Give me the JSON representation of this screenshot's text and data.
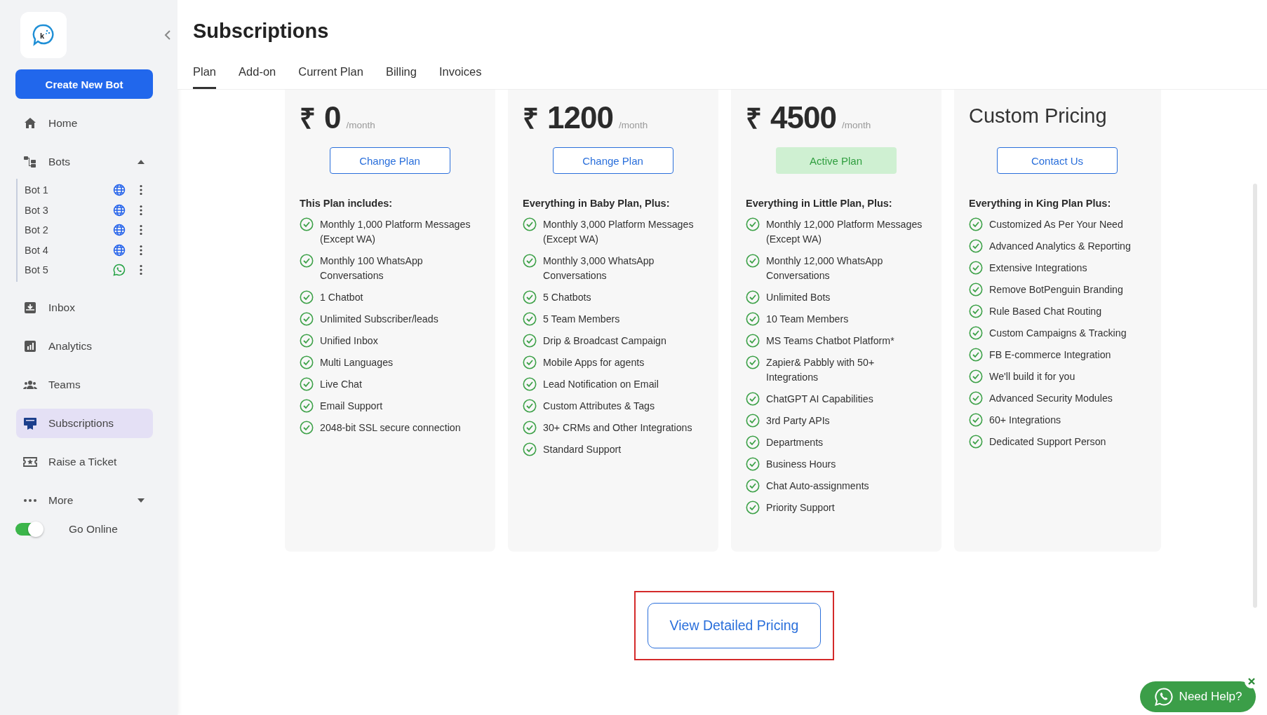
{
  "sidebar": {
    "logo_letter": "k",
    "create_button": "Create New Bot",
    "items": [
      {
        "kind": "home",
        "label": "Home",
        "selected": false
      },
      {
        "kind": "bots",
        "label": "Bots",
        "selected": false,
        "expanded": true,
        "children": [
          {
            "label": "Bot 1",
            "kind": "web"
          },
          {
            "label": "Bot 3",
            "kind": "web"
          },
          {
            "label": "Bot 2",
            "kind": "web"
          },
          {
            "label": "Bot 4",
            "kind": "web"
          },
          {
            "label": "Bot 5",
            "kind": "whatsapp"
          }
        ]
      },
      {
        "kind": "inbox",
        "label": "Inbox",
        "selected": false
      },
      {
        "kind": "analytics",
        "label": "Analytics",
        "selected": false
      },
      {
        "kind": "teams",
        "label": "Teams",
        "selected": false
      },
      {
        "kind": "subscriptions",
        "label": "Subscriptions",
        "selected": true
      },
      {
        "kind": "ticket",
        "label": "Raise a Ticket",
        "selected": false
      },
      {
        "kind": "more",
        "label": "More",
        "selected": false,
        "expanded": false
      }
    ],
    "go_online": {
      "label": "Go Online",
      "on": true
    }
  },
  "page": {
    "title": "Subscriptions"
  },
  "tabs": [
    {
      "label": "Plan",
      "selected": true
    },
    {
      "label": "Add-on",
      "selected": false
    },
    {
      "label": "Current Plan",
      "selected": false
    },
    {
      "label": "Billing",
      "selected": false
    },
    {
      "label": "Invoices",
      "selected": false
    }
  ],
  "plans": [
    {
      "currency": "₹",
      "price": "0",
      "period": "/month",
      "button": {
        "label": "Change Plan",
        "kind": "outline"
      },
      "heading": "This Plan includes:",
      "features": [
        "Monthly 1,000 Platform Messages (Except WA)",
        "Monthly 100 WhatsApp Conversations",
        "1 Chatbot",
        "Unlimited Subscriber/leads",
        "Unified Inbox",
        "Multi Languages",
        "Live Chat",
        "Email Support",
        "2048-bit SSL secure connection"
      ]
    },
    {
      "currency": "₹",
      "price": "1200",
      "period": "/month",
      "button": {
        "label": "Change Plan",
        "kind": "outline"
      },
      "heading": "Everything in Baby Plan, Plus:",
      "features": [
        "Monthly 3,000 Platform Messages (Except WA)",
        "Monthly 3,000 WhatsApp Conversations",
        "5 Chatbots",
        "5 Team Members",
        "Drip & Broadcast Campaign",
        "Mobile Apps for agents",
        "Lead Notification on Email",
        "Custom Attributes & Tags",
        "30+ CRMs and Other Integrations",
        "Standard Support"
      ]
    },
    {
      "currency": "₹",
      "price": "4500",
      "period": "/month",
      "button": {
        "label": "Active Plan",
        "kind": "active"
      },
      "heading": "Everything in Little Plan, Plus:",
      "features": [
        "Monthly 12,000 Platform Messages (Except WA)",
        "Monthly 12,000 WhatsApp Conversations",
        "Unlimited Bots",
        "10 Team Members",
        "MS Teams Chatbot Platform*",
        "Zapier& Pabbly with 50+ Integrations",
        "ChatGPT AI Capabilities",
        "3rd Party APIs",
        "Departments",
        "Business Hours",
        "Chat Auto-assignments",
        "Priority Support"
      ]
    },
    {
      "custom_price": "Custom Pricing",
      "button": {
        "label": "Contact Us",
        "kind": "outline"
      },
      "heading": "Everything in King Plan Plus:",
      "features": [
        "Customized As Per Your Need",
        "Advanced Analytics & Reporting",
        "Extensive Integrations",
        "Remove BotPenguin Branding",
        "Rule Based Chat Routing",
        "Custom Campaigns & Tracking",
        "FB E-commerce Integration",
        "We'll build it for you",
        "Advanced Security Modules",
        "60+ Integrations",
        "Dedicated Support Person"
      ]
    }
  ],
  "detailed_pricing_button": "View Detailed Pricing",
  "help_button": "Need Help?"
}
